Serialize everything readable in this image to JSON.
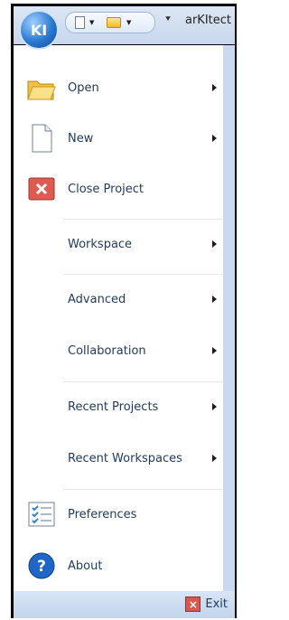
{
  "titlebar": {
    "title": "arKItect",
    "logo_text": "KI"
  },
  "quick_access": {
    "new_icon": "new-document-icon",
    "open_icon": "open-folder-icon",
    "customize_icon": "customize-icon"
  },
  "menu": {
    "items": [
      {
        "label": "Open",
        "has_submenu": true,
        "icon": "folder-open-icon"
      },
      {
        "label": "New",
        "has_submenu": true,
        "icon": "new-document-icon"
      },
      {
        "label": "Close Project",
        "has_submenu": false,
        "icon": "close-project-icon"
      },
      {
        "label": "Workspace",
        "has_submenu": true,
        "icon": ""
      },
      {
        "label": "Advanced",
        "has_submenu": true,
        "icon": ""
      },
      {
        "label": "Collaboration",
        "has_submenu": true,
        "icon": ""
      },
      {
        "label": "Recent Projects",
        "has_submenu": true,
        "icon": ""
      },
      {
        "label": "Recent Workspaces",
        "has_submenu": true,
        "icon": ""
      },
      {
        "label": "Preferences",
        "has_submenu": false,
        "icon": "preferences-icon"
      },
      {
        "label": "About",
        "has_submenu": false,
        "icon": "help-icon"
      }
    ]
  },
  "footer": {
    "exit_label": "Exit",
    "exit_icon": "exit-icon"
  },
  "colors": {
    "menu_text": "#1e395b",
    "titlebar": "#c8d7ed",
    "footer": "#c3d4ec"
  }
}
